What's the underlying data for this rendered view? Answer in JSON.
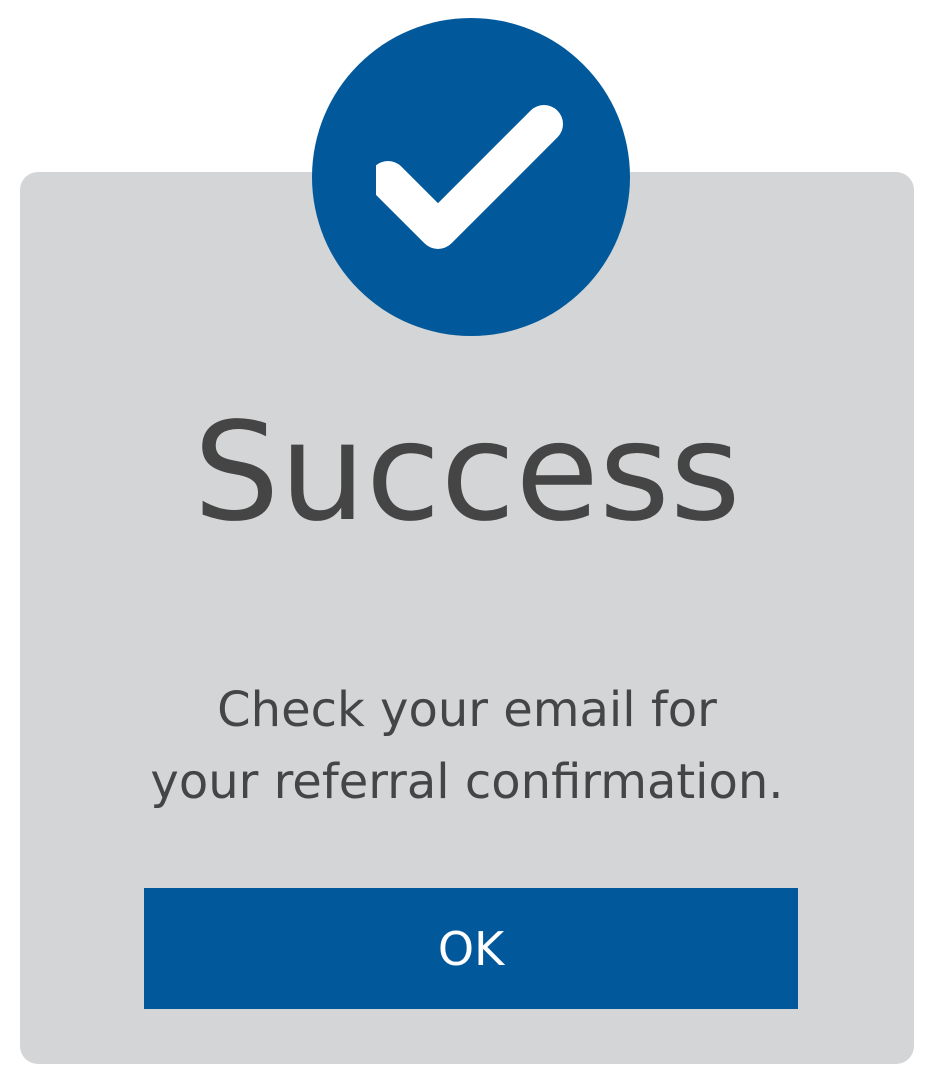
{
  "dialog": {
    "title": "Success",
    "message_line1": "Check your email for",
    "message_line2": "your referral confirmation.",
    "ok_label": "OK",
    "icon": "checkmark-icon"
  },
  "colors": {
    "accent": "#01599c",
    "panel": "#d4d5d6",
    "text": "#454545",
    "button_text": "#ffffff"
  }
}
